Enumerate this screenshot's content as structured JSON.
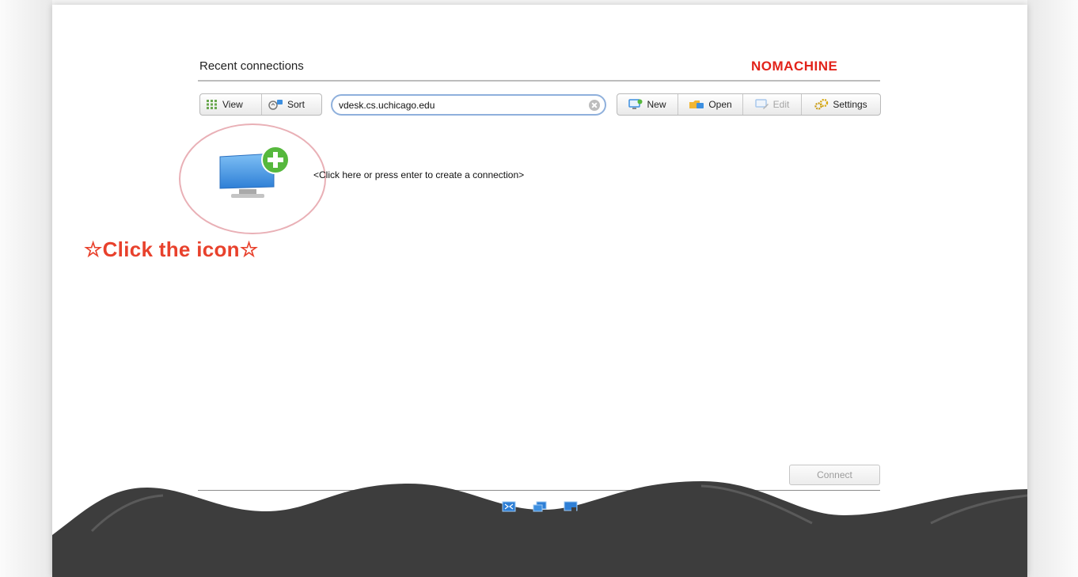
{
  "header": {
    "section_title": "Recent connections",
    "brand": "NOMACHINE"
  },
  "toolbar_left": {
    "view_label": "View",
    "sort_label": "Sort"
  },
  "search": {
    "value": "vdesk.cs.uchicago.edu",
    "placeholder": ""
  },
  "toolbar_right": {
    "new_label": "New",
    "open_label": "Open",
    "edit_label": "Edit",
    "settings_label": "Settings"
  },
  "main": {
    "create_hint": "<Click here or press enter to create a connection>"
  },
  "annotation": {
    "text": "☆Click the icon☆"
  },
  "footer": {
    "connect_label": "Connect"
  },
  "colors": {
    "brand": "#e2231a",
    "annotation": "#e8412c",
    "footer_dark": "#3d3d3d",
    "plus_green": "#56b83d",
    "monitor_blue": "#3d8fe0"
  },
  "icons": [
    "grid-view-icon",
    "sort-icon",
    "clear-icon",
    "new-connection-icon",
    "open-folder-icon",
    "edit-icon",
    "settings-gears-icon",
    "monitor-add-icon",
    "fullscreen-icon",
    "multi-window-icon",
    "display-icon"
  ]
}
